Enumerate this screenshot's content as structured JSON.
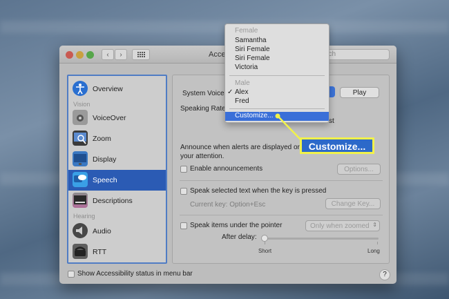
{
  "window": {
    "title": "Acce",
    "search_placeholder": "earch"
  },
  "sidebar": {
    "items": [
      {
        "label": "Overview",
        "icon": "accessibility-icon"
      },
      {
        "label": "VoiceOver",
        "icon": "voiceover-icon"
      },
      {
        "label": "Zoom",
        "icon": "zoom-icon"
      },
      {
        "label": "Display",
        "icon": "display-icon"
      },
      {
        "label": "Speech",
        "icon": "speech-icon",
        "selected": true
      },
      {
        "label": "Descriptions",
        "icon": "descriptions-icon"
      },
      {
        "label": "Audio",
        "icon": "audio-icon"
      },
      {
        "label": "RTT",
        "icon": "rtt-icon"
      }
    ],
    "sections": {
      "vision": "Vision",
      "hearing": "Hearing"
    }
  },
  "speech": {
    "system_voice_label": "System Voice",
    "play_label": "Play",
    "speaking_rate_label": "Speaking Rate",
    "rate_right_fragment": "st",
    "announce_line1": "Announce when alerts are displayed or",
    "announce_line2": "your attention.",
    "enable_announcements": "Enable announcements",
    "options_label": "Options...",
    "speak_selected": "Speak selected text when the key is pressed",
    "current_key": "Current key: Option+Esc",
    "change_key": "Change Key...",
    "speak_items": "Speak items under the pointer",
    "only_when_zoomed": "Only when zoomed",
    "after_delay": "After delay:",
    "short_label": "Short",
    "long_label": "Long"
  },
  "footer": {
    "show_status": "Show Accessibility status in menu bar",
    "help": "?"
  },
  "voice_menu": {
    "female_header": "Female",
    "female": [
      "Samantha",
      "Siri Female",
      "Siri Female",
      "Victoria"
    ],
    "male_header": "Male",
    "male": [
      "Alex",
      "Fred"
    ],
    "checked": "Alex",
    "customize": "Customize..."
  },
  "callout": {
    "label": "Customize...",
    "border_color": "#f1f24a",
    "fill_color": "#2c69c9"
  }
}
